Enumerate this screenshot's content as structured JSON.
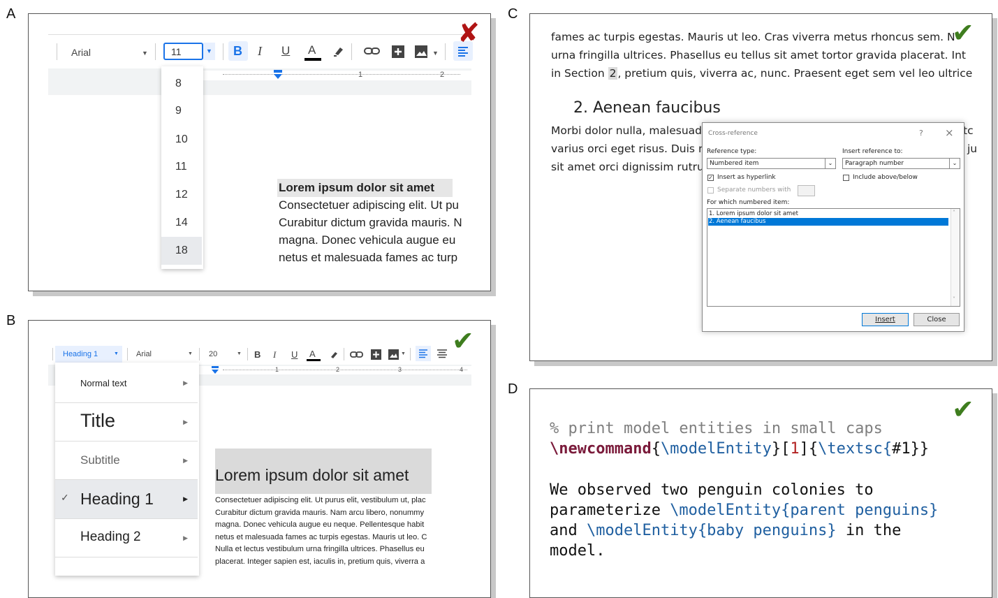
{
  "labels": {
    "a": "A",
    "b": "B",
    "c": "C",
    "d": "D"
  },
  "colors": {
    "check": "#3e7d1e",
    "cross": "#b01414",
    "accent": "#1a73e8",
    "highlight": "#cde8ff"
  },
  "marks": {
    "check": "✔",
    "cross": "✘"
  },
  "panel_a": {
    "toolbar": {
      "font": "Arial",
      "size": "11",
      "bold": "B",
      "italic": "I",
      "underline": "U",
      "text_color": "A"
    },
    "ruler": {
      "one": "1",
      "two": "2"
    },
    "size_options": [
      "8",
      "9",
      "10",
      "11",
      "12",
      "14",
      "18"
    ],
    "heading": "Lorem ipsum dolor sit amet",
    "body": [
      "Consectetuer adipiscing elit. Ut pu",
      "Curabitur dictum gravida mauris. N",
      "magna. Donec vehicula augue eu",
      "netus et malesuada fames ac turp"
    ]
  },
  "panel_b": {
    "toolbar": {
      "style": "Heading 1",
      "font": "Arial",
      "size": "20",
      "bold": "B",
      "italic": "I",
      "underline": "U",
      "text_color": "A"
    },
    "ruler": {
      "one": "1",
      "two": "2",
      "three": "3",
      "four": "4"
    },
    "styles": [
      "Normal text",
      "Title",
      "Subtitle",
      "Heading 1",
      "Heading 2"
    ],
    "heading": "Lorem ipsum dolor sit amet",
    "body": [
      "Consectetuer adipiscing elit. Ut purus elit, vestibulum ut, plac",
      "Curabitur dictum gravida mauris. Nam arcu libero, nonummy",
      "magna. Donec vehicula augue eu neque. Pellentesque habit",
      "netus et malesuada fames ac turpis egestas. Mauris ut leo. C",
      "Nulla et lectus vestibulum urna fringilla ultrices.  Phasellus eu",
      "placerat. Integer sapien est, iaculis in, pretium quis, viverra a"
    ]
  },
  "panel_c": {
    "lines": [
      "fames ac turpis egestas. Mauris ut leo. Cras viverra metus rhoncus sem. N",
      "urna fringilla ultrices.  Phasellus eu tellus sit amet tortor gravida placerat. Int"
    ],
    "line3_before": "in Section ",
    "line3_ref": "2",
    "line3_after": ", pretium quis, viverra ac, nunc. Praesent eget sem vel leo ultrices",
    "heading": "2. Aenean faucibus",
    "para": [
      "Morbi dolor nulla, malesuad",
      "varius orci eget risus. Duis n",
      "sit amet orci dignissim rutru"
    ],
    "para_right": [
      "tc",
      "ju"
    ],
    "dialog": {
      "title": "Cross-reference",
      "help": "?",
      "close": "×",
      "ref_type_label": "Reference type:",
      "ref_type_value": "Numbered item",
      "insert_ref_label": "Insert reference to:",
      "insert_ref_value": "Paragraph number",
      "hyperlink_label": "Insert as hyperlink",
      "include_label": "Include above/below",
      "separate_label": "Separate numbers with",
      "which_label": "For which numbered item:",
      "items": [
        "1. Lorem ipsum dolor sit amet",
        "2. Aenean faucibus"
      ],
      "insert_button": "Insert",
      "close_button": "Close"
    }
  },
  "panel_d": {
    "comment": "% print model entities in small caps",
    "cmd": "\\newcommand",
    "b1": "{",
    "arg1": "\\modelEntity",
    "b2": "}[",
    "n": "1",
    "b3": "]{",
    "textsc": "\\textsc{",
    "hash": "#1}}",
    "p1": "We observed two penguin colonies to",
    "p2a": "parameterize ",
    "me": "\\modelEntity",
    "p2b": "{parent penguins}",
    "p3a": "and ",
    "p3b": "{baby penguins}",
    "p3c": " in the",
    "p4": "model."
  }
}
